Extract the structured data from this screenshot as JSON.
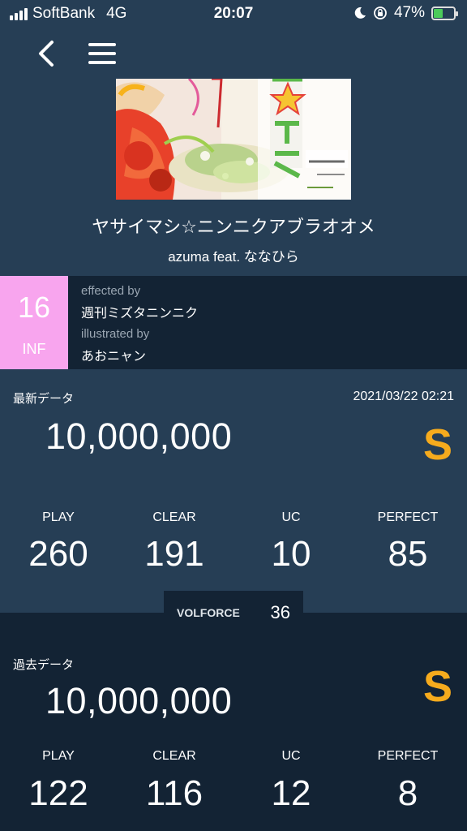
{
  "status_bar": {
    "carrier": "SoftBank",
    "network": "4G",
    "time": "20:07",
    "battery": "47%",
    "battery_level": 0.47
  },
  "song": {
    "title": "ヤサイマシ☆ニンニクアブラオオメ",
    "artist": "azuma feat. ななひら"
  },
  "chart": {
    "level": "16",
    "difficulty": "INF",
    "effected_by_label": "effected by",
    "effected_by": "週刊ミズタニンニク",
    "illustrated_by_label": "illustrated by",
    "illustrated_by": "あおニャン"
  },
  "latest": {
    "label": "最新データ",
    "date": "2021/03/22 02:21",
    "score": "10,000,000",
    "grade": "S",
    "stats": [
      {
        "label": "PLAY",
        "value": "260"
      },
      {
        "label": "CLEAR",
        "value": "191"
      },
      {
        "label": "UC",
        "value": "10"
      },
      {
        "label": "PERFECT",
        "value": "85"
      }
    ]
  },
  "volforce": {
    "label": "VOLFORCE",
    "value": "36"
  },
  "past": {
    "label": "過去データ",
    "score": "10,000,000",
    "grade": "S",
    "stats": [
      {
        "label": "PLAY",
        "value": "122"
      },
      {
        "label": "CLEAR",
        "value": "116"
      },
      {
        "label": "UC",
        "value": "12"
      },
      {
        "label": "PERFECT",
        "value": "8"
      }
    ]
  },
  "colors": {
    "panel_light": "#263e55",
    "panel_dark": "#132334",
    "level_badge": "#f8a5ee",
    "grade": "#f6ab1d"
  },
  "icons": [
    "signal-icon",
    "moon-icon",
    "rotation-lock-icon",
    "battery-icon",
    "back-chevron-icon",
    "hamburger-menu-icon"
  ]
}
